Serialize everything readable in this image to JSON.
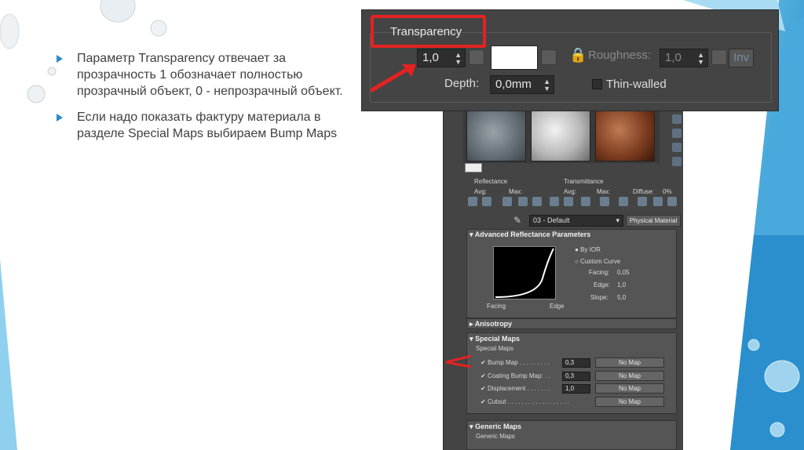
{
  "bullets": [
    "Параметр Transparency отвечает за прозрачность 1 обозначает полностью прозрачный объект, 0 - непрозрачный объект.",
    "Если надо показать фактуру материала в разделе Special Maps выбираем Bump Maps"
  ],
  "popup": {
    "title": "Transparency",
    "value": "1,0",
    "roughness_label": "Roughness:",
    "roughness_value": "1,0",
    "inv_label": "Inv",
    "depth_label": "Depth:",
    "depth_value": "0,0mm",
    "thin_walled_label": "Thin-walled"
  },
  "editor": {
    "reflectance_label": "Reflectance",
    "transmittance_label": "Transmittance",
    "avg_label": "Avg:",
    "max_label": "Max:",
    "diffuse_label": "Diffuse:",
    "diffuse_value": "0%",
    "material_name": "03 - Default",
    "material_type": "Physical Material",
    "adv_reflectance_title": "Advanced Reflectance Parameters",
    "by_ior": "By IOR",
    "custom_curve": "Custom Curve",
    "facing_label": "Facing:",
    "facing_value": "0,05",
    "edge_label": "Edge:",
    "edge_value": "1,0",
    "slope_label": "Slope:",
    "slope_value": "5,0",
    "graph_facing": "Facing",
    "graph_edge": "Edge",
    "anisotropy_title": "Anisotropy",
    "special_maps_title": "Special Maps",
    "special_maps_sub": "Special Maps",
    "maps": [
      {
        "label": "Bump Map . . . . . . . . .",
        "value": "0,3",
        "button": "No Map"
      },
      {
        "label": "Coating Bump Map: . .",
        "value": "0,3",
        "button": "No Map"
      },
      {
        "label": "Displacement . . . . . . .",
        "value": "1,0",
        "button": "No Map"
      },
      {
        "label": "Cutout . . . . . . . . . . . . . . . . . .",
        "value": "",
        "button": "No Map"
      }
    ],
    "generic_maps_title": "Generic Maps",
    "generic_maps_sub": "Generic Maps"
  }
}
